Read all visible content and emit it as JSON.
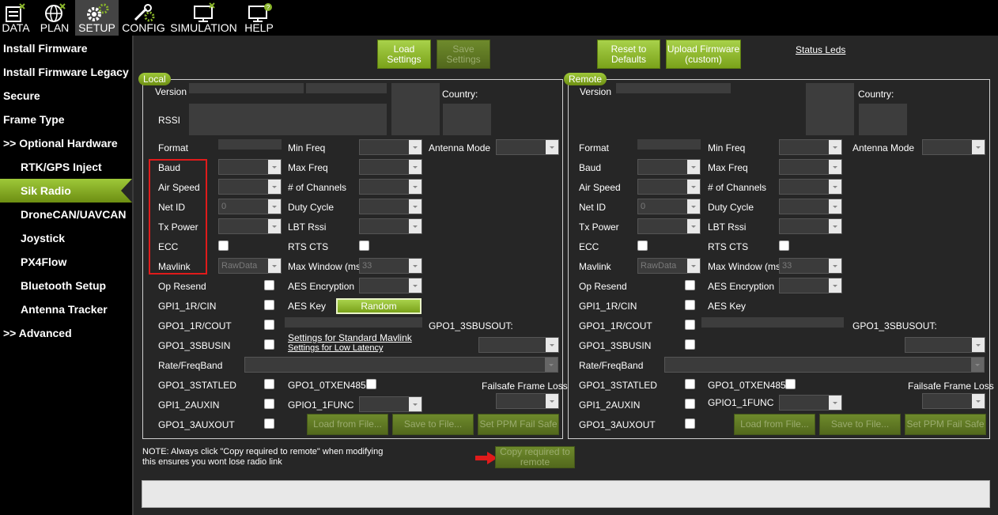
{
  "menu": [
    {
      "label": "DATA",
      "icon": "data-icon"
    },
    {
      "label": "PLAN",
      "icon": "globe-icon"
    },
    {
      "label": "SETUP",
      "icon": "gears-icon"
    },
    {
      "label": "CONFIG",
      "icon": "wrench-icon"
    },
    {
      "label": "SIMULATION",
      "icon": "monitor-icon"
    },
    {
      "label": "HELP",
      "icon": "help-monitor-icon"
    }
  ],
  "sidebar": [
    "Install Firmware",
    "Install Firmware Legacy",
    "Secure",
    "Frame Type",
    ">> Optional Hardware",
    "RTK/GPS Inject",
    "Sik Radio",
    "DroneCAN/UAVCAN",
    "Joystick",
    "PX4Flow",
    "Bluetooth Setup",
    "Antenna Tracker",
    ">> Advanced"
  ],
  "toolbar": {
    "load_settings": "Load Settings",
    "save_settings": "Save Settings",
    "reset_defaults": "Reset to Defaults",
    "upload_firmware": "Upload Firmware (custom)",
    "status_leds": "Status Leds"
  },
  "local": {
    "legend": "Local",
    "version": "Version",
    "rssi": "RSSI",
    "country": "Country:",
    "format": "Format",
    "baud": "Baud",
    "air_speed": "Air Speed",
    "net_id": "Net ID",
    "net_id_value": "0",
    "tx_power": "Tx Power",
    "ecc": "ECC",
    "mavlink": "Mavlink",
    "mavlink_value": "RawData",
    "op_resend": "Op Resend",
    "gpi1_1r_cin": "GPI1_1R/CIN",
    "gpo1_1r_cout": "GPO1_1R/COUT",
    "gpo1_3sbusin": "GPO1_3SBUSIN",
    "rate_freqband": "Rate/FreqBand",
    "gpo1_3statled": "GPO1_3STATLED",
    "gpi1_2auxin": "GPI1_2AUXIN",
    "gpo1_3auxout": "GPO1_3AUXOUT",
    "min_freq": "Min Freq",
    "max_freq": "Max Freq",
    "num_channels": "# of Channels",
    "duty_cycle": "Duty Cycle",
    "lbt_rssi": "LBT Rssi",
    "rts_cts": "RTS CTS",
    "max_window": "Max Window (ms)",
    "max_window_value": "33",
    "aes_encryption": "AES Encryption",
    "aes_key": "AES Key",
    "random_button": "Random",
    "settings_std_mavlink": "Settings for Standard Mavlink",
    "settings_low_latency": "Settings for Low Latency",
    "gpo1_0txen485": "GPO1_0TXEN485",
    "gpio1_1func": "GPIO1_1FUNC",
    "antenna_mode": "Antenna Mode",
    "gpo1_3sbusout": "GPO1_3SBUSOUT:",
    "failsafe_frame_loss": "Failsafe Frame Loss",
    "load_from_file": "Load from File...",
    "save_to_file": "Save to File...",
    "set_ppm_failsafe": "Set PPM Fail Safe"
  },
  "remote": {
    "legend": "Remote",
    "version": "Version",
    "country": "Country:",
    "format": "Format",
    "baud": "Baud",
    "air_speed": "Air Speed",
    "net_id": "Net ID",
    "net_id_value": "0",
    "tx_power": "Tx Power",
    "ecc": "ECC",
    "mavlink": "Mavlink",
    "mavlink_value": "RawData",
    "op_resend": "Op Resend",
    "gpi1_1r_cin": "GPI1_1R/CIN",
    "gpo1_1r_cout": "GPO1_1R/COUT",
    "gpo1_3sbusin": "GPO1_3SBUSIN",
    "rate_freqband": "Rate/FreqBand",
    "gpo1_3statled": "GPO1_3STATLED",
    "gpi1_2auxin": "GPI1_2AUXIN",
    "gpo1_3auxout": "GPO1_3AUXOUT",
    "min_freq": "Min Freq",
    "max_freq": "Max Freq",
    "num_channels": "# of Channels",
    "duty_cycle": "Duty Cycle",
    "lbt_rssi": "LBT Rssi",
    "rts_cts": "RTS CTS",
    "max_window": "Max Window (ms)",
    "max_window_value": "33",
    "aes_encryption": "AES Encryption",
    "aes_key": "AES Key",
    "gpo1_0txen485": "GPO1_0TXEN485",
    "gpio1_1func": "GPIO1_1FUNC",
    "antenna_mode": "Antenna Mode",
    "gpo1_3sbusout": "GPO1_3SBUSOUT:",
    "failsafe_frame_loss": "Failsafe Frame Loss",
    "load_from_file": "Load from File...",
    "save_to_file": "Save to File...",
    "set_ppm_failsafe": "Set PPM Fail Safe"
  },
  "note": {
    "line1": "NOTE: Always click \"Copy required to remote\" when modifying",
    "line2": "this ensures you wont lose radio link"
  },
  "copy_required_button": "Copy required to remote",
  "colors": {
    "accent": "#8ab52a",
    "background": "#262626",
    "highlight": "#e01b1b"
  }
}
